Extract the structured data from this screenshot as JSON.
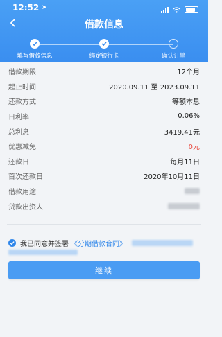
{
  "status_bar": {
    "time": "12:52",
    "location_icon": "location-arrow-icon"
  },
  "nav": {
    "back_icon": "chevron-left-icon",
    "title": "借款信息"
  },
  "steps": [
    {
      "label": "填写借款信息",
      "state": "done"
    },
    {
      "label": "绑定银行卡",
      "state": "done"
    },
    {
      "label": "确认订单",
      "state": "pending"
    }
  ],
  "details": [
    {
      "label": "借款期限",
      "value": "12个月"
    },
    {
      "label": "起止时间",
      "value": "2020.09.11 至 2023.09.11"
    },
    {
      "label": "还款方式",
      "value": "等额本息"
    },
    {
      "label": "日利率",
      "value": "0.06%"
    },
    {
      "label": "总利息",
      "value": "3419.41元"
    },
    {
      "label": "优惠减免",
      "value": "0元"
    },
    {
      "label": "还款日",
      "value": "每月11日"
    },
    {
      "label": "首次还款日",
      "value": "2020年10月11日"
    },
    {
      "label": "借款用途",
      "value": ""
    },
    {
      "label": "贷款出资人",
      "value": ""
    }
  ],
  "agreement": {
    "text": "我已同意并签署",
    "contract": "《分期借款合同》"
  },
  "continue_button": "继续",
  "colors": {
    "primary": "#3a8ef0",
    "accent_red": "#e9453a"
  }
}
